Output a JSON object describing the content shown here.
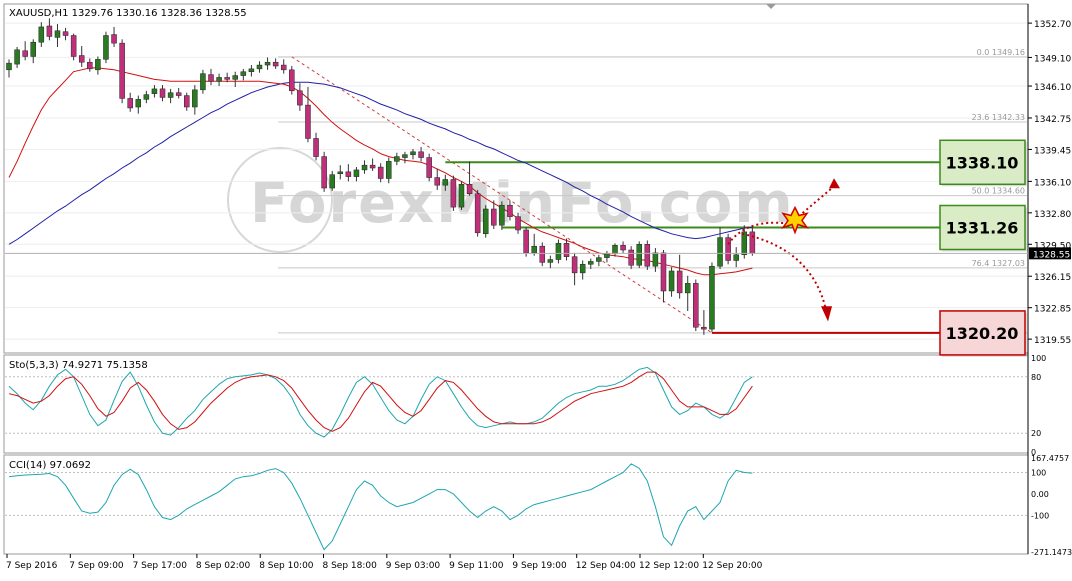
{
  "chart_data": {
    "type": "candlestick",
    "symbol_header": "XAUUSD,H1  1329.76 1330.16 1328.36 1328.55",
    "price_axis": {
      "ylim": [
        1318.2,
        1354.6
      ],
      "ticks": [
        "1352.70",
        "1349.10",
        "1346.10",
        "1342.75",
        "1339.45",
        "1336.10",
        "1332.80",
        "1329.50",
        "1326.15",
        "1322.85",
        "1319.55"
      ],
      "tick_values": [
        1352.7,
        1349.1,
        1346.1,
        1342.75,
        1339.45,
        1336.1,
        1332.8,
        1329.5,
        1326.15,
        1322.85,
        1319.55
      ],
      "current_price_label": "1328.55",
      "current_price": 1328.55
    },
    "time_labels": [
      "7 Sep 2016",
      "7 Sep 09:00",
      "7 Sep 17:00",
      "8 Sep 02:00",
      "8 Sep 10:00",
      "8 Sep 18:00",
      "9 Sep 03:00",
      "9 Sep 11:00",
      "9 Sep 19:00",
      "12 Sep 04:00",
      "12 Sep 12:00",
      "12 Sep 20:00"
    ],
    "candles": [
      [
        1347.8,
        1348.9,
        1347.0,
        1348.5
      ],
      [
        1348.4,
        1350.2,
        1348.0,
        1349.9
      ],
      [
        1349.8,
        1350.8,
        1348.8,
        1349.2
      ],
      [
        1349.2,
        1351.0,
        1348.5,
        1350.7
      ],
      [
        1350.7,
        1352.8,
        1350.2,
        1352.3
      ],
      [
        1352.4,
        1353.2,
        1350.9,
        1351.3
      ],
      [
        1351.2,
        1352.6,
        1350.2,
        1351.9
      ],
      [
        1351.8,
        1352.2,
        1350.9,
        1351.4
      ],
      [
        1351.4,
        1351.6,
        1348.8,
        1349.2
      ],
      [
        1349.3,
        1350.3,
        1348.1,
        1348.6
      ],
      [
        1348.6,
        1349.0,
        1347.6,
        1347.9
      ],
      [
        1347.8,
        1349.2,
        1347.3,
        1348.9
      ],
      [
        1348.9,
        1351.8,
        1348.5,
        1351.4
      ],
      [
        1351.5,
        1352.3,
        1350.2,
        1350.6
      ],
      [
        1350.6,
        1351.0,
        1344.3,
        1344.8
      ],
      [
        1344.8,
        1345.4,
        1343.4,
        1343.8
      ],
      [
        1343.9,
        1345.1,
        1343.2,
        1344.7
      ],
      [
        1344.7,
        1345.6,
        1344.3,
        1345.2
      ],
      [
        1345.3,
        1346.2,
        1344.9,
        1345.8
      ],
      [
        1345.8,
        1346.2,
        1344.5,
        1344.9
      ],
      [
        1344.9,
        1345.8,
        1344.3,
        1345.4
      ],
      [
        1345.4,
        1345.9,
        1344.8,
        1345.1
      ],
      [
        1345.1,
        1345.4,
        1343.5,
        1343.9
      ],
      [
        1343.9,
        1346.2,
        1343.1,
        1345.7
      ],
      [
        1345.7,
        1347.8,
        1345.3,
        1347.4
      ],
      [
        1347.3,
        1347.9,
        1346.2,
        1346.6
      ],
      [
        1346.6,
        1347.4,
        1346.1,
        1347.0
      ],
      [
        1347.0,
        1347.5,
        1346.5,
        1346.8
      ],
      [
        1346.8,
        1347.6,
        1346.0,
        1347.2
      ],
      [
        1347.2,
        1347.9,
        1346.7,
        1347.6
      ],
      [
        1347.6,
        1348.3,
        1347.1,
        1347.9
      ],
      [
        1347.9,
        1348.7,
        1347.5,
        1348.3
      ],
      [
        1348.3,
        1349.1,
        1347.8,
        1348.6
      ],
      [
        1348.6,
        1349.0,
        1347.9,
        1348.2
      ],
      [
        1348.3,
        1348.9,
        1347.4,
        1347.8
      ],
      [
        1347.8,
        1348.2,
        1345.2,
        1345.6
      ],
      [
        1345.6,
        1346.4,
        1343.5,
        1344.1
      ],
      [
        1344.1,
        1346.0,
        1340.2,
        1340.6
      ],
      [
        1340.6,
        1341.2,
        1338.3,
        1338.7
      ],
      [
        1338.7,
        1339.2,
        1335.0,
        1335.4
      ],
      [
        1335.4,
        1337.2,
        1335.1,
        1336.8
      ],
      [
        1336.9,
        1337.8,
        1336.3,
        1337.1
      ],
      [
        1337.1,
        1337.9,
        1336.1,
        1336.6
      ],
      [
        1336.6,
        1337.6,
        1336.1,
        1337.3
      ],
      [
        1337.3,
        1338.3,
        1336.9,
        1337.8
      ],
      [
        1337.8,
        1338.5,
        1337.2,
        1337.5
      ],
      [
        1337.6,
        1338.0,
        1336.0,
        1336.4
      ],
      [
        1336.4,
        1338.6,
        1335.9,
        1338.2
      ],
      [
        1338.2,
        1339.1,
        1337.8,
        1338.7
      ],
      [
        1338.6,
        1339.2,
        1338.0,
        1338.9
      ],
      [
        1338.9,
        1339.5,
        1338.4,
        1339.2
      ],
      [
        1339.2,
        1339.7,
        1338.2,
        1338.6
      ],
      [
        1338.6,
        1339.0,
        1336.1,
        1336.5
      ],
      [
        1336.5,
        1337.4,
        1335.2,
        1335.7
      ],
      [
        1335.7,
        1336.8,
        1335.1,
        1336.3
      ],
      [
        1336.3,
        1336.7,
        1333.0,
        1333.4
      ],
      [
        1333.4,
        1336.1,
        1333.1,
        1335.8
      ],
      [
        1335.8,
        1338.2,
        1334.6,
        1334.8
      ],
      [
        1334.8,
        1335.2,
        1330.3,
        1330.7
      ],
      [
        1330.6,
        1333.6,
        1330.2,
        1333.2
      ],
      [
        1333.2,
        1334.1,
        1331.1,
        1331.5
      ],
      [
        1331.5,
        1334.0,
        1331.0,
        1333.6
      ],
      [
        1333.6,
        1334.1,
        1332.0,
        1332.4
      ],
      [
        1332.4,
        1332.8,
        1330.6,
        1331.0
      ],
      [
        1331.0,
        1331.3,
        1328.2,
        1328.6
      ],
      [
        1328.6,
        1330.6,
        1328.3,
        1329.3
      ],
      [
        1329.3,
        1329.7,
        1327.2,
        1327.6
      ],
      [
        1327.6,
        1328.3,
        1327.0,
        1327.9
      ],
      [
        1327.9,
        1330.0,
        1327.5,
        1329.6
      ],
      [
        1329.6,
        1330.1,
        1327.8,
        1328.2
      ],
      [
        1328.2,
        1328.6,
        1325.2,
        1326.5
      ],
      [
        1326.5,
        1327.8,
        1325.8,
        1327.4
      ],
      [
        1327.4,
        1328.0,
        1326.9,
        1327.7
      ],
      [
        1327.7,
        1328.4,
        1327.2,
        1328.1
      ],
      [
        1328.1,
        1328.8,
        1327.6,
        1328.5
      ],
      [
        1328.5,
        1329.6,
        1328.2,
        1329.4
      ],
      [
        1329.4,
        1329.8,
        1328.6,
        1328.9
      ],
      [
        1328.9,
        1329.3,
        1326.9,
        1327.3
      ],
      [
        1327.3,
        1329.8,
        1327.0,
        1329.5
      ],
      [
        1329.5,
        1329.9,
        1326.8,
        1327.2
      ],
      [
        1327.2,
        1329.1,
        1326.6,
        1328.6
      ],
      [
        1328.6,
        1328.9,
        1323.4,
        1324.6
      ],
      [
        1324.6,
        1327.1,
        1324.0,
        1326.7
      ],
      [
        1326.7,
        1328.4,
        1323.8,
        1324.4
      ],
      [
        1324.4,
        1326.2,
        1322.5,
        1325.4
      ],
      [
        1325.4,
        1325.8,
        1320.4,
        1320.8
      ],
      [
        1320.8,
        1322.6,
        1320.0,
        1320.6
      ],
      [
        1320.6,
        1327.6,
        1320.3,
        1327.2
      ],
      [
        1327.2,
        1331.3,
        1326.9,
        1330.2
      ],
      [
        1330.2,
        1330.6,
        1327.4,
        1327.8
      ],
      [
        1327.8,
        1329.2,
        1327.1,
        1328.4
      ],
      [
        1328.4,
        1331.5,
        1328.0,
        1330.8
      ],
      [
        1330.8,
        1331.4,
        1328.3,
        1328.55
      ]
    ],
    "ma_red": [
      1336.5,
      1338.2,
      1340.1,
      1341.9,
      1343.6,
      1344.9,
      1345.8,
      1346.7,
      1347.6,
      1347.8,
      1348.0,
      1348.0,
      1347.9,
      1347.8,
      1347.6,
      1347.4,
      1347.2,
      1347.0,
      1346.8,
      1346.7,
      1346.6,
      1346.6,
      1346.6,
      1346.6,
      1346.6,
      1346.6,
      1346.6,
      1346.6,
      1346.6,
      1346.6,
      1346.6,
      1346.6,
      1346.5,
      1346.4,
      1346.3,
      1346.0,
      1345.5,
      1344.8,
      1344.0,
      1343.1,
      1342.3,
      1341.6,
      1341.0,
      1340.4,
      1339.9,
      1339.5,
      1339.0,
      1338.7,
      1338.5,
      1338.3,
      1338.2,
      1338.1,
      1337.8,
      1337.4,
      1337.0,
      1336.5,
      1336.1,
      1335.6,
      1334.9,
      1334.3,
      1333.8,
      1333.3,
      1332.8,
      1332.2,
      1331.7,
      1331.2,
      1330.8,
      1330.5,
      1330.2,
      1329.9,
      1329.6,
      1329.2,
      1328.9,
      1328.6,
      1328.4,
      1328.3,
      1328.2,
      1328.0,
      1327.9,
      1327.8,
      1327.6,
      1327.4,
      1327.2,
      1327.0,
      1326.8,
      1326.5,
      1326.3,
      1326.3,
      1326.4,
      1326.5,
      1326.6,
      1326.8,
      1327.0
    ],
    "ma_blue": [
      1329.5,
      1330.0,
      1330.6,
      1331.2,
      1331.8,
      1332.4,
      1333.0,
      1333.5,
      1334.1,
      1334.7,
      1335.2,
      1335.8,
      1336.4,
      1336.9,
      1337.5,
      1338.0,
      1338.6,
      1339.1,
      1339.7,
      1340.2,
      1340.8,
      1341.3,
      1341.8,
      1342.3,
      1342.8,
      1343.3,
      1343.7,
      1344.2,
      1344.6,
      1345.0,
      1345.4,
      1345.7,
      1346.0,
      1346.2,
      1346.4,
      1346.5,
      1346.5,
      1346.5,
      1346.4,
      1346.3,
      1346.1,
      1345.9,
      1345.6,
      1345.3,
      1345.0,
      1344.6,
      1344.2,
      1343.9,
      1343.6,
      1343.2,
      1342.9,
      1342.6,
      1342.2,
      1341.9,
      1341.6,
      1341.2,
      1340.9,
      1340.5,
      1340.2,
      1339.8,
      1339.5,
      1339.1,
      1338.7,
      1338.3,
      1338.0,
      1337.6,
      1337.2,
      1336.8,
      1336.4,
      1336.0,
      1335.5,
      1335.1,
      1334.6,
      1334.2,
      1333.7,
      1333.3,
      1332.9,
      1332.4,
      1332.0,
      1331.6,
      1331.2,
      1330.9,
      1330.6,
      1330.4,
      1330.2,
      1330.1,
      1330.2,
      1330.4,
      1330.6,
      1330.8,
      1331.0,
      1331.2,
      1331.3
    ],
    "fibonacci": [
      {
        "label": "0.0  1349.16",
        "price": 1349.16
      },
      {
        "label": "23.6  1342.33",
        "price": 1342.33
      },
      {
        "label": "50.0  1334.60",
        "price": 1334.6
      },
      {
        "label": "76.4  1327.03",
        "price": 1327.03
      },
      {
        "label": "100.0  1320.20",
        "price": 1320.2
      }
    ],
    "levels": [
      {
        "label": "1338.10",
        "price": 1338.1,
        "color": "#3c8a1c",
        "fill": "#d9ecc5"
      },
      {
        "label": "1331.26",
        "price": 1331.26,
        "color": "#3c8a1c",
        "fill": "#d9ecc5"
      },
      {
        "label": "1320.20",
        "price": 1320.2,
        "color": "#c00000",
        "fill": "#f6d6d6"
      }
    ],
    "stochastic": {
      "title": "Sto(5,3,3) 74.9271 75.1358",
      "ylim": [
        0,
        100
      ],
      "ticks": [
        "100",
        "80",
        "20",
        "0"
      ],
      "tick_values": [
        100,
        80,
        20,
        0
      ],
      "main": [
        70,
        62,
        52,
        45,
        55,
        70,
        82,
        88,
        80,
        60,
        40,
        28,
        34,
        55,
        75,
        85,
        70,
        50,
        32,
        20,
        18,
        26,
        36,
        44,
        56,
        64,
        72,
        78,
        80,
        81,
        82,
        84,
        82,
        78,
        70,
        58,
        40,
        28,
        20,
        16,
        24,
        40,
        58,
        74,
        80,
        72,
        58,
        44,
        34,
        30,
        38,
        56,
        72,
        80,
        76,
        62,
        48,
        36,
        28,
        26,
        28,
        30,
        32,
        30,
        30,
        32,
        36,
        44,
        52,
        58,
        62,
        64,
        66,
        70,
        70,
        72,
        76,
        82,
        88,
        90,
        84,
        66,
        48,
        40,
        44,
        52,
        48,
        40,
        36,
        42,
        58,
        74,
        80
      ],
      "signal": [
        62,
        60,
        56,
        52,
        54,
        60,
        70,
        78,
        80,
        72,
        60,
        46,
        38,
        42,
        54,
        68,
        74,
        66,
        54,
        40,
        30,
        24,
        26,
        32,
        42,
        52,
        60,
        68,
        74,
        78,
        80,
        81,
        82,
        80,
        76,
        68,
        56,
        44,
        34,
        26,
        22,
        26,
        36,
        50,
        64,
        74,
        70,
        60,
        50,
        42,
        38,
        44,
        56,
        68,
        76,
        74,
        66,
        56,
        46,
        38,
        32,
        30,
        30,
        30,
        30,
        30,
        32,
        36,
        42,
        48,
        54,
        58,
        62,
        64,
        66,
        68,
        70,
        74,
        80,
        85,
        85,
        78,
        66,
        54,
        48,
        48,
        48,
        44,
        40,
        40,
        46,
        58,
        70
      ]
    },
    "cci": {
      "title": "CCI(14) 97.0692",
      "ylim": [
        -271.1473,
        167.4757
      ],
      "ticks": [
        "167.4757",
        "100",
        "0.00",
        "-100",
        "-271.1473"
      ],
      "tick_values": [
        167.4757,
        100,
        0,
        -100,
        -271.1473
      ],
      "values": [
        80,
        85,
        88,
        90,
        92,
        95,
        80,
        40,
        -20,
        -80,
        -90,
        -85,
        -40,
        40,
        90,
        115,
        90,
        20,
        -60,
        -110,
        -120,
        -100,
        -70,
        -50,
        -30,
        -10,
        10,
        40,
        70,
        80,
        85,
        95,
        110,
        118,
        100,
        50,
        -20,
        -100,
        -180,
        -260,
        -220,
        -140,
        -60,
        20,
        60,
        40,
        -10,
        -40,
        -60,
        -50,
        -40,
        -20,
        0,
        20,
        20,
        0,
        -40,
        -80,
        -110,
        -80,
        -60,
        -80,
        -120,
        -100,
        -70,
        -50,
        -40,
        -30,
        -20,
        -10,
        0,
        10,
        20,
        40,
        60,
        80,
        100,
        140,
        120,
        60,
        -60,
        -200,
        -240,
        -150,
        -80,
        -60,
        -120,
        -80,
        -40,
        60,
        110,
        100,
        97
      ]
    },
    "watermark": "ForexMinFo.com"
  }
}
